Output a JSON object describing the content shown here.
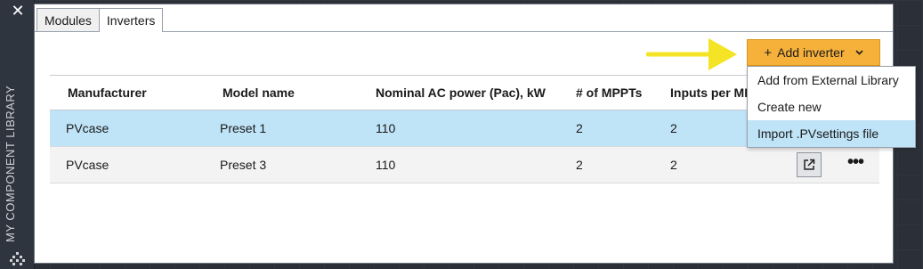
{
  "palette": {
    "title": "MY COMPONENT LIBRARY",
    "close_icon": "close-icon",
    "grip_icon": "grip-icon"
  },
  "tabs": [
    {
      "label": "Modules",
      "active": false
    },
    {
      "label": "Inverters",
      "active": true
    }
  ],
  "toolbar": {
    "add_button_label": "Add inverter",
    "add_icon": "plus-icon",
    "chevron_icon": "chevron-down-icon",
    "accent_color": "#f6b13b",
    "arrow_color": "#f5e425"
  },
  "menu": {
    "items": [
      {
        "label": "Add from External Library",
        "highlighted": false
      },
      {
        "label": "Create new",
        "highlighted": false
      },
      {
        "label": "Import .PVsettings file",
        "highlighted": true
      }
    ]
  },
  "table": {
    "columns": [
      "Manufacturer",
      "Model name",
      "Nominal AC power (Pac), kW",
      "# of MPPTs",
      "Inputs per MPPT"
    ],
    "rows": [
      {
        "manufacturer": "PVcase",
        "model": "Preset 1",
        "power": "110",
        "mppts": "2",
        "inputs": "2",
        "selected": true
      },
      {
        "manufacturer": "PVcase",
        "model": "Preset 3",
        "power": "110",
        "mppts": "2",
        "inputs": "2",
        "selected": false
      }
    ],
    "row_actions": {
      "open_icon": "open-external-icon",
      "more_icon": "more-options-icon",
      "more_glyph": "•••"
    },
    "selected_color": "#bfe3f7"
  }
}
